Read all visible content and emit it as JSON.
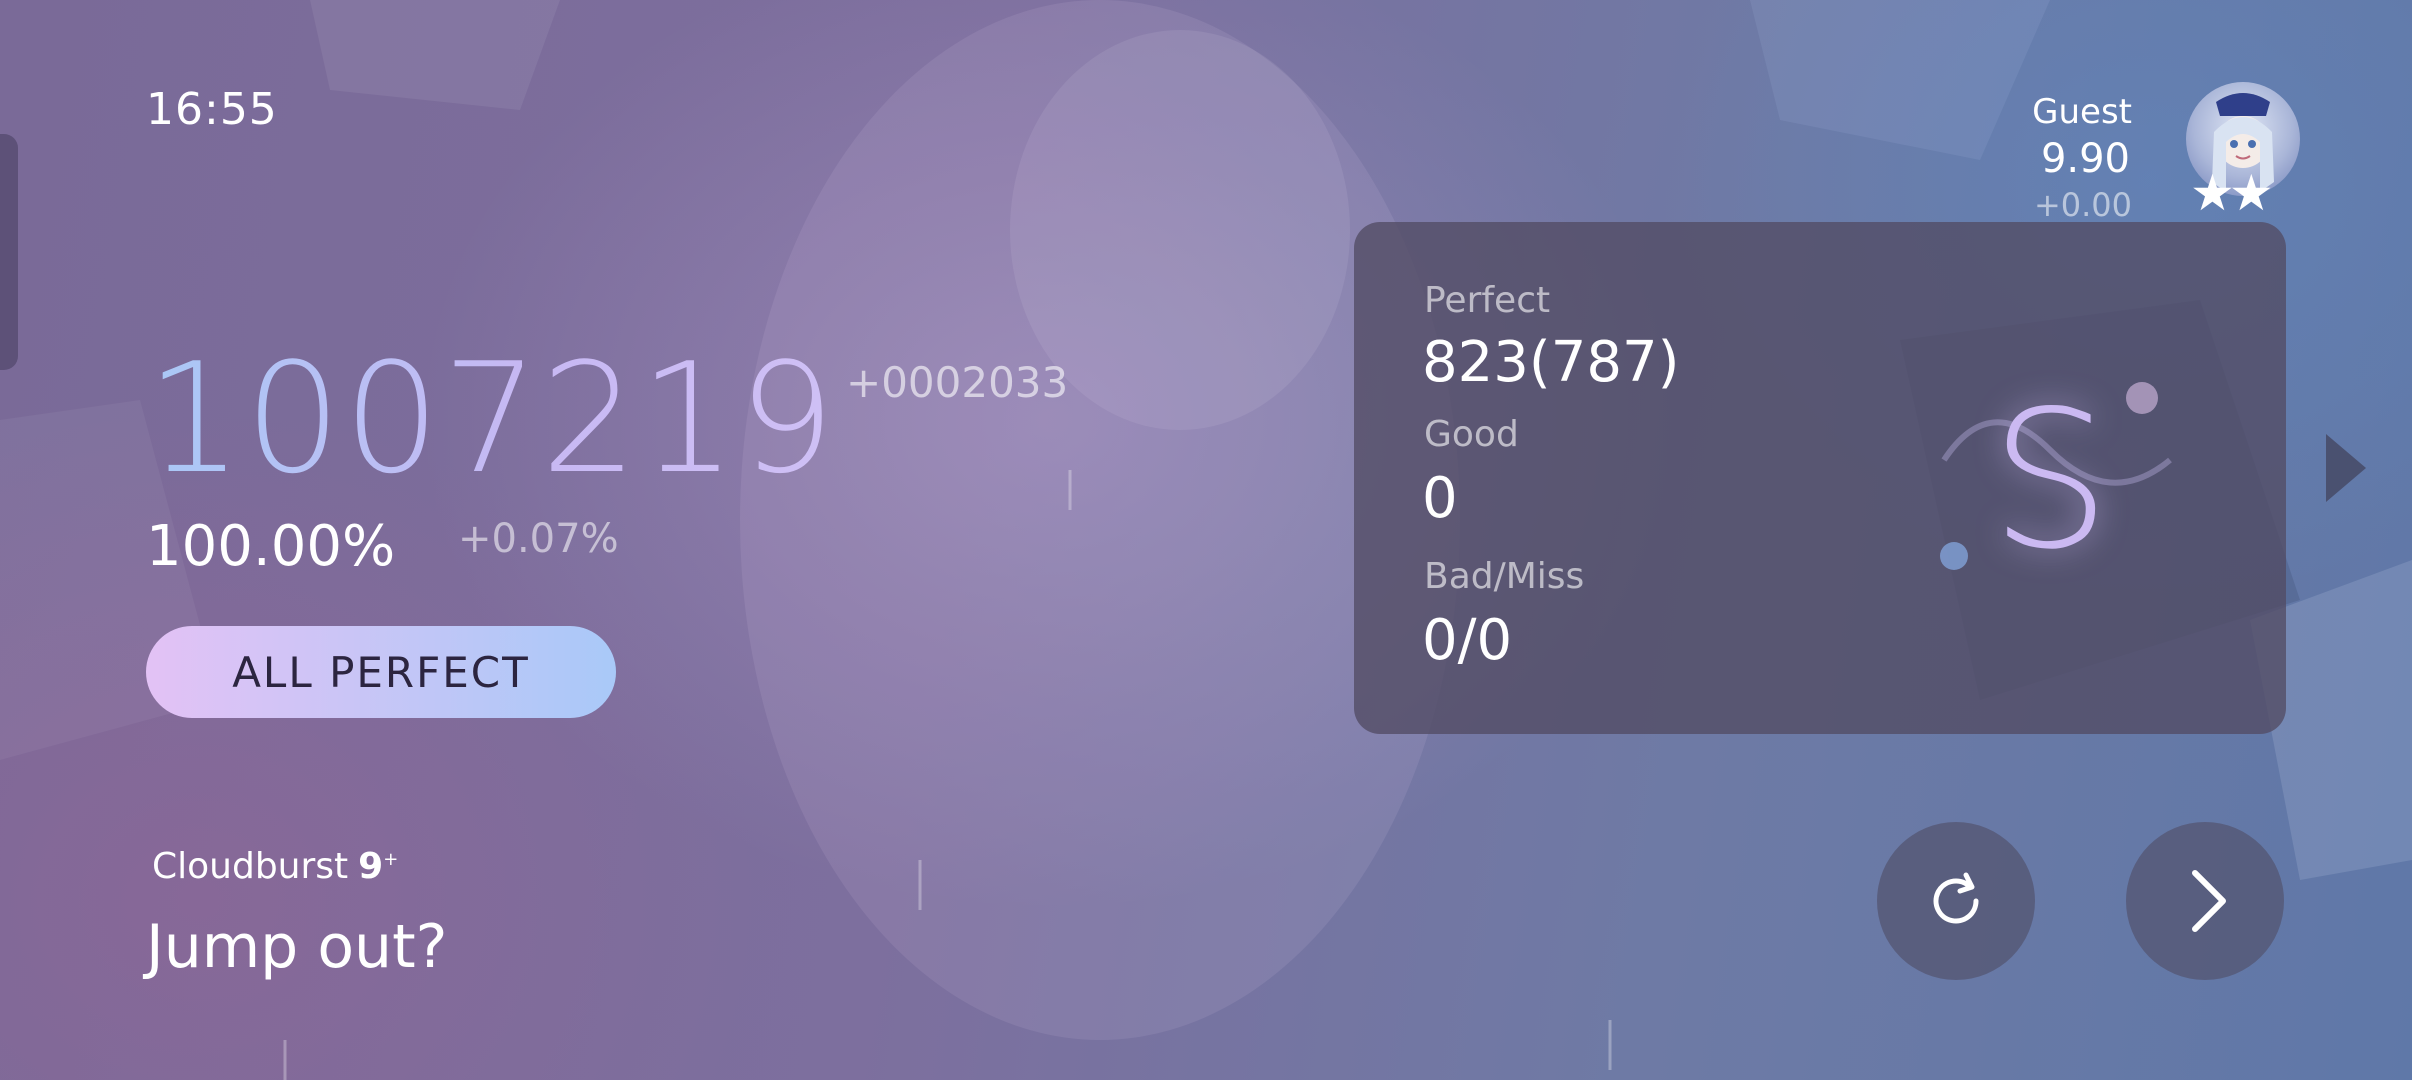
{
  "clock": "16:55",
  "player": {
    "name": "Guest",
    "rks": "9.90",
    "rks_delta": "+0.00",
    "avatar_stars": "★★"
  },
  "result": {
    "score": "1007219",
    "score_delta": "+0002033",
    "accuracy": "100.00%",
    "accuracy_delta": "+0.07%",
    "badge": "ALL PERFECT"
  },
  "song": {
    "title": "Cloudburst",
    "level": "9",
    "level_suffix": "+",
    "prompt": "Jump out?"
  },
  "stats": {
    "perfect_label": "Perfect",
    "perfect_value": "823(787)",
    "good_label": "Good",
    "good_value": "0",
    "badmiss_label": "Bad/Miss",
    "badmiss_value": "0/0"
  },
  "grade": "S",
  "colors": {
    "badge_start": "#e3c2f5",
    "badge_end": "#a9c9f8",
    "score_gradient_start": "#a9c8f6",
    "grade": "#cbb9f2"
  },
  "icons": {
    "retry": "retry-icon",
    "next": "chevron-right-icon",
    "side_next": "play-triangle-icon"
  }
}
